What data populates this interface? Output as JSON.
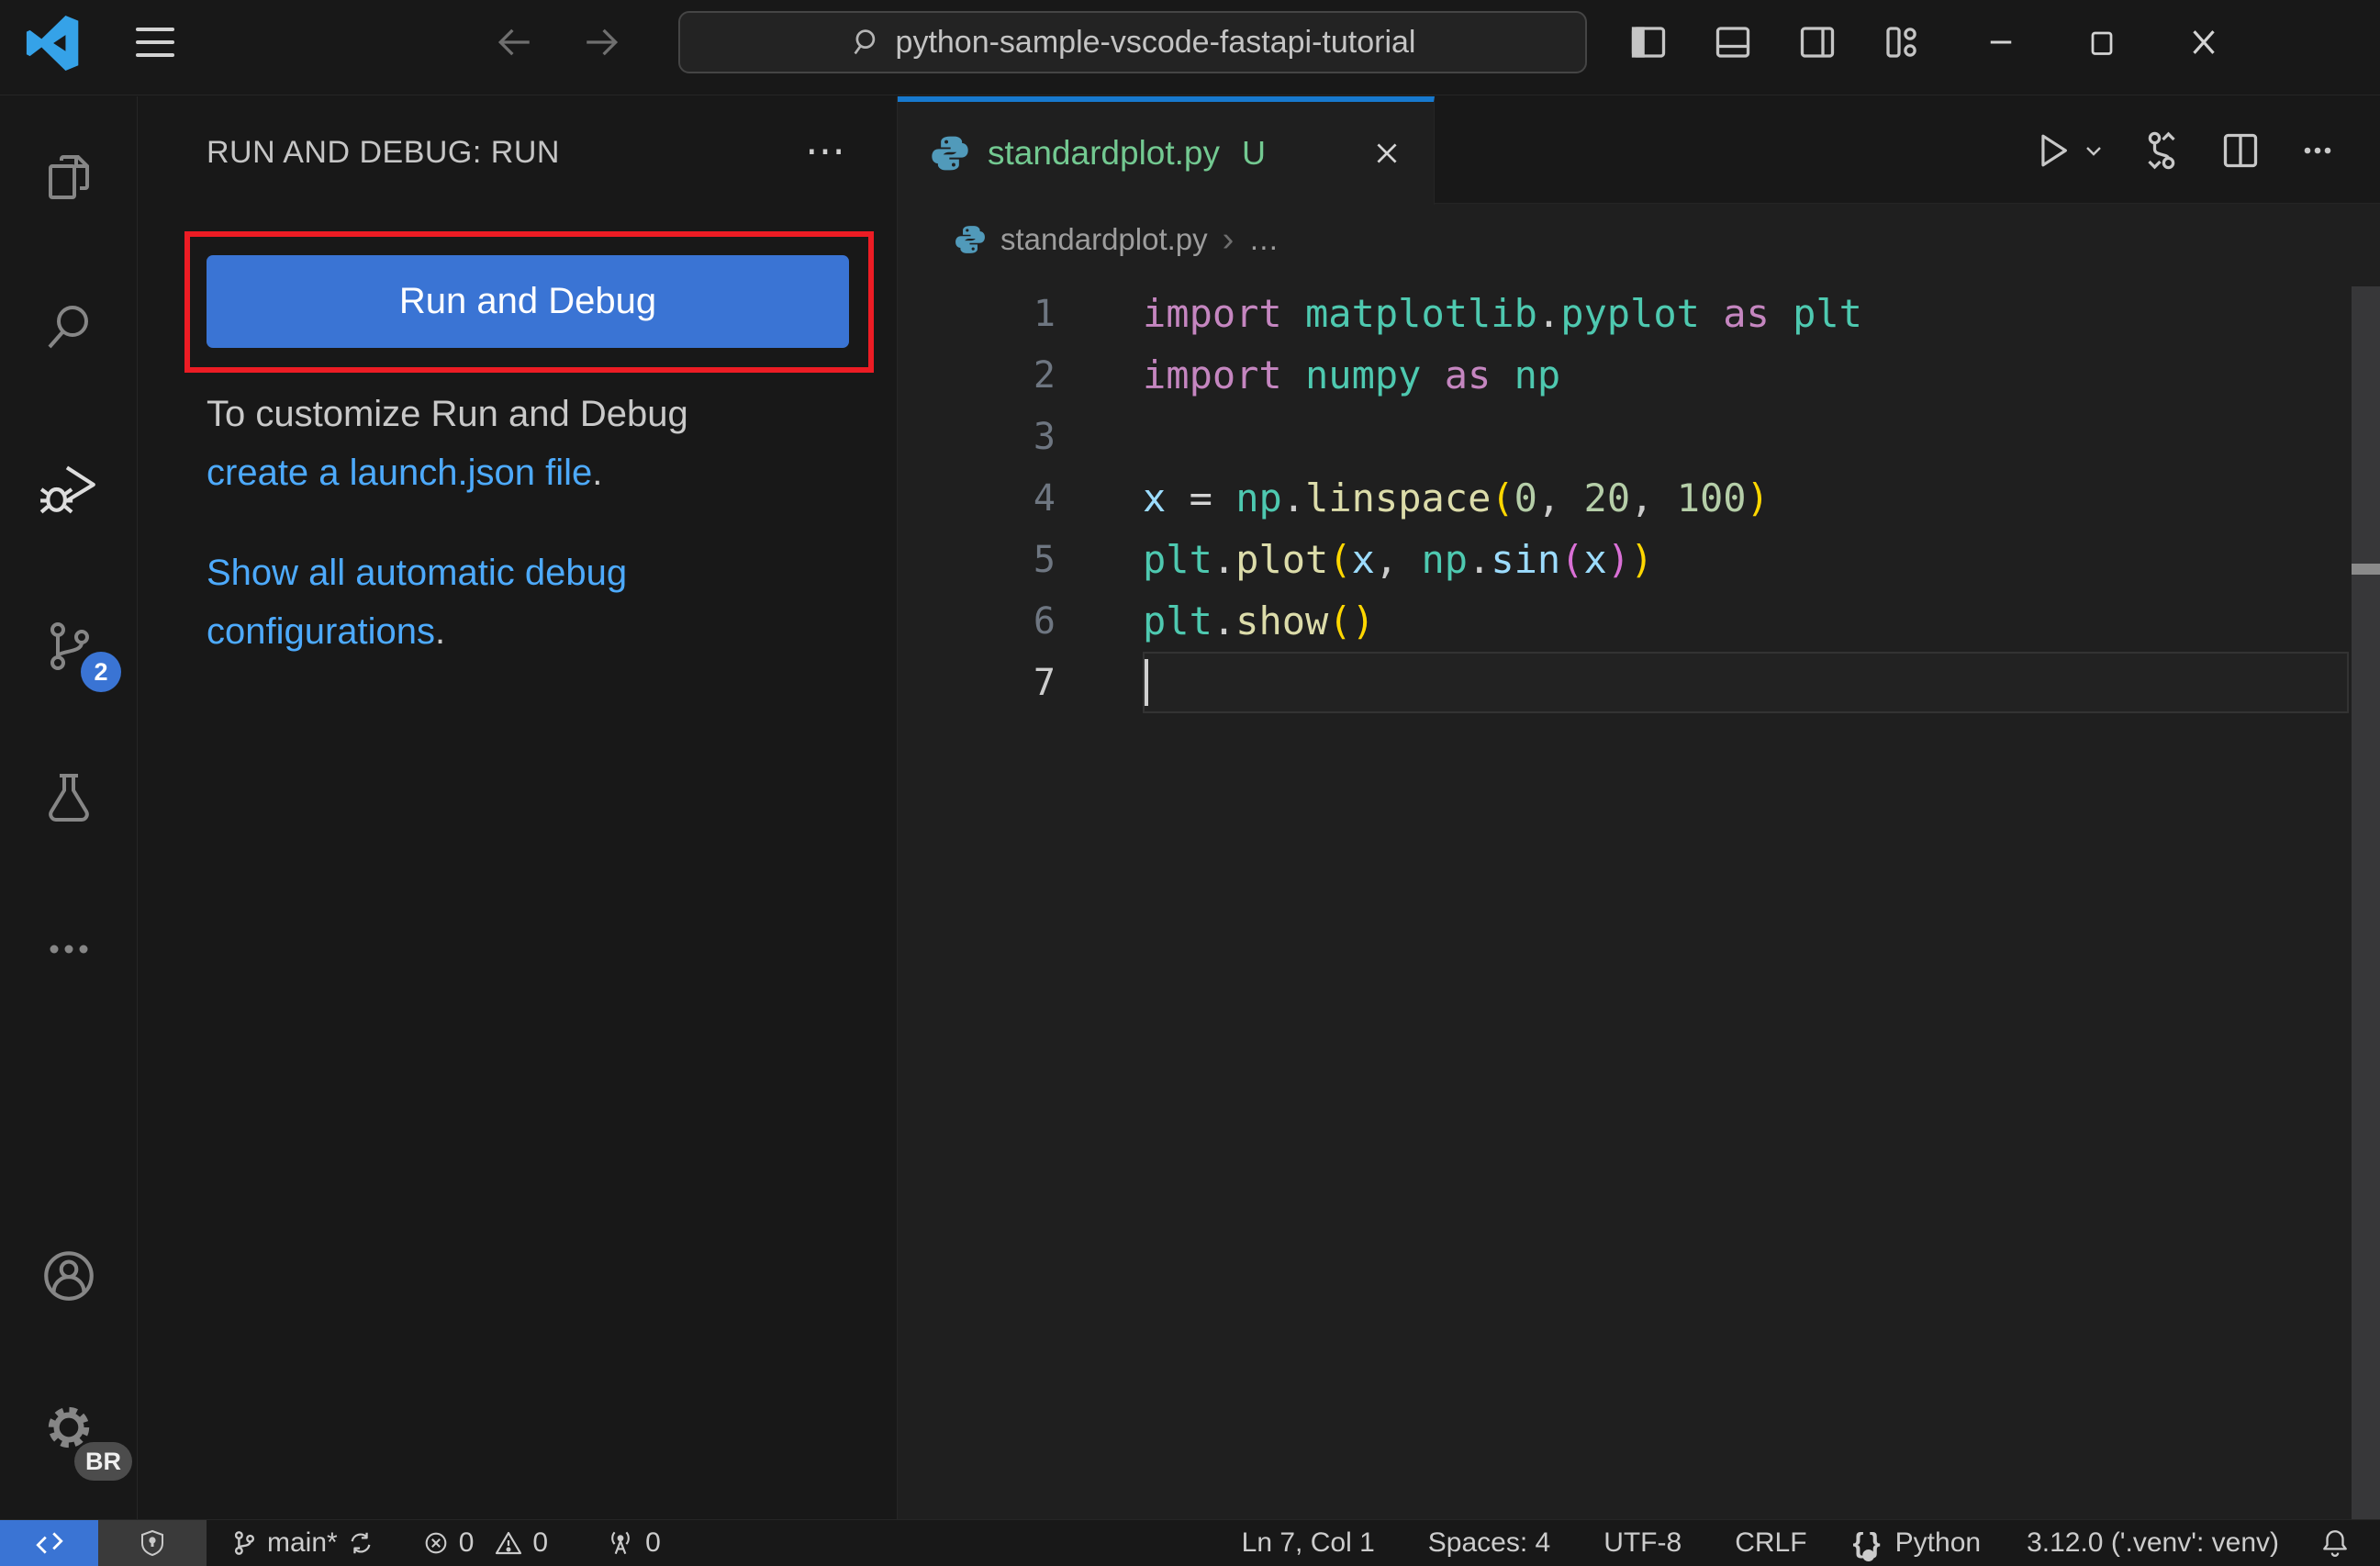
{
  "colors": {
    "accent_blue": "#3a74d4",
    "tab_active_border": "#1779ce",
    "link_blue": "#4daafc",
    "annotation_red": "#ec1c24",
    "untracked_green": "#73c991",
    "editor_bg": "#1f1f1f",
    "chrome_bg": "#181818"
  },
  "title_bar": {
    "search_value": "python-sample-vscode-fastapi-tutorial"
  },
  "activity_bar": {
    "source_control_badge": "2",
    "settings_badge": "BR"
  },
  "sidebar": {
    "header": "RUN AND DEBUG: RUN",
    "more_label": "⋯",
    "run_button_label": "Run and Debug",
    "hint_prefix": "To customize Run and Debug ",
    "launch_link": "create a launch.json file",
    "hint_suffix": ".",
    "auto_link": "Show all automatic debug configurations",
    "auto_suffix": "."
  },
  "editor": {
    "tab": {
      "name": "standardplot.py",
      "modified": "U"
    },
    "breadcrumb": {
      "file": "standardplot.py",
      "more": "…"
    },
    "code": {
      "lines": [
        {
          "num": "1",
          "tokens": [
            [
              "kw",
              "import"
            ],
            [
              "pl",
              " "
            ],
            [
              "type",
              "matplotlib"
            ],
            [
              "pu",
              "."
            ],
            [
              "type",
              "pyplot"
            ],
            [
              "pl",
              " "
            ],
            [
              "kw",
              "as"
            ],
            [
              "pl",
              " "
            ],
            [
              "type",
              "plt"
            ]
          ]
        },
        {
          "num": "2",
          "tokens": [
            [
              "kw",
              "import"
            ],
            [
              "pl",
              " "
            ],
            [
              "type",
              "numpy"
            ],
            [
              "pl",
              " "
            ],
            [
              "kw",
              "as"
            ],
            [
              "pl",
              " "
            ],
            [
              "type",
              "np"
            ]
          ]
        },
        {
          "num": "3",
          "tokens": []
        },
        {
          "num": "4",
          "tokens": [
            [
              "var",
              "x"
            ],
            [
              "pl",
              " "
            ],
            [
              "op",
              "="
            ],
            [
              "pl",
              " "
            ],
            [
              "type",
              "np"
            ],
            [
              "pu",
              "."
            ],
            [
              "fn",
              "linspace"
            ],
            [
              "b1",
              "("
            ],
            [
              "num",
              "0"
            ],
            [
              "pu",
              ", "
            ],
            [
              "num",
              "20"
            ],
            [
              "pu",
              ", "
            ],
            [
              "num",
              "100"
            ],
            [
              "b1",
              ")"
            ]
          ]
        },
        {
          "num": "5",
          "tokens": [
            [
              "type",
              "plt"
            ],
            [
              "pu",
              "."
            ],
            [
              "fn",
              "plot"
            ],
            [
              "b1",
              "("
            ],
            [
              "var",
              "x"
            ],
            [
              "pu",
              ", "
            ],
            [
              "type",
              "np"
            ],
            [
              "pu",
              "."
            ],
            [
              "var",
              "sin"
            ],
            [
              "b2",
              "("
            ],
            [
              "var",
              "x"
            ],
            [
              "b2",
              ")"
            ],
            [
              "b1",
              ")"
            ]
          ]
        },
        {
          "num": "6",
          "tokens": [
            [
              "type",
              "plt"
            ],
            [
              "pu",
              "."
            ],
            [
              "fn",
              "show"
            ],
            [
              "b1",
              "("
            ],
            [
              "b1",
              ")"
            ]
          ]
        },
        {
          "num": "7",
          "tokens": [],
          "cursor": true
        }
      ]
    }
  },
  "status_bar": {
    "branch": "main*",
    "errors": "0",
    "warnings": "0",
    "ports": "0",
    "line_col": "Ln 7, Col 1",
    "spaces": "Spaces: 4",
    "encoding": "UTF-8",
    "eol": "CRLF",
    "language": "Python",
    "interpreter": "3.12.0 ('.venv': venv)"
  }
}
